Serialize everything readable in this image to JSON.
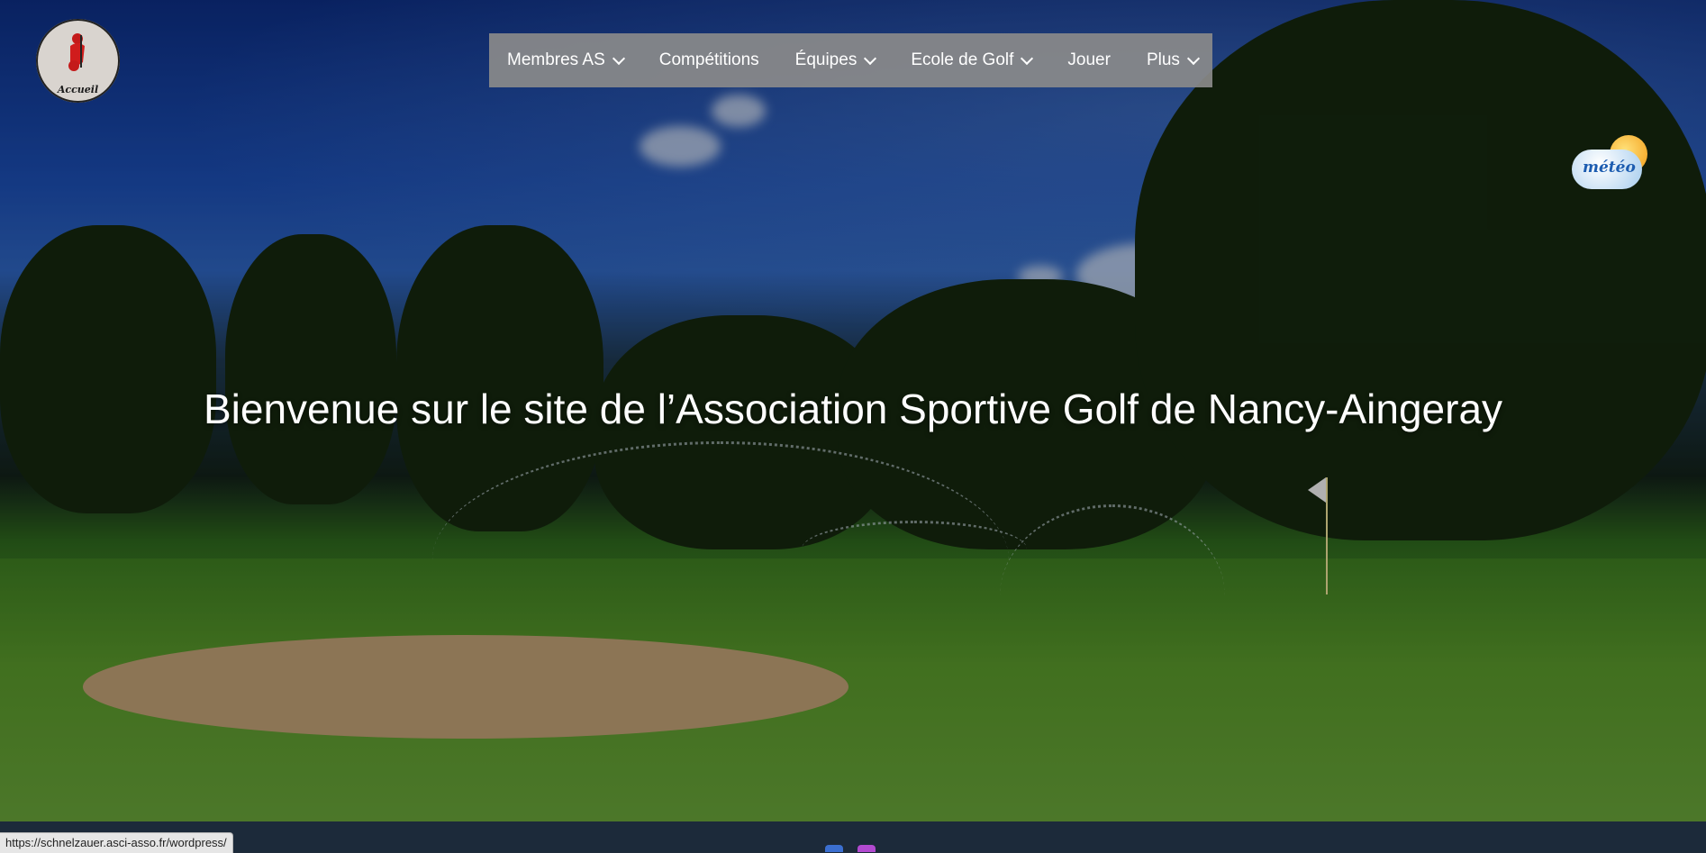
{
  "logo": {
    "label": "Accueil"
  },
  "nav": {
    "items": [
      {
        "label": "Membres AS",
        "has_dropdown": true
      },
      {
        "label": "Compétitions",
        "has_dropdown": false
      },
      {
        "label": "Équipes",
        "has_dropdown": true
      },
      {
        "label": "Ecole de Golf",
        "has_dropdown": true
      },
      {
        "label": "Jouer",
        "has_dropdown": false
      },
      {
        "label": "Plus",
        "has_dropdown": true
      }
    ]
  },
  "weather_widget": {
    "label": "météo"
  },
  "hero": {
    "title": "Bienvenue sur le site de l’Association Sportive Golf de Nancy-Aingeray"
  },
  "status_bar": {
    "url": "https://schnelzauer.asci-asso.fr/wordpress/"
  },
  "colors": {
    "nav_bg": "#8a8a8a",
    "text": "#ffffff",
    "footer_bg": "#1c2a3a"
  }
}
